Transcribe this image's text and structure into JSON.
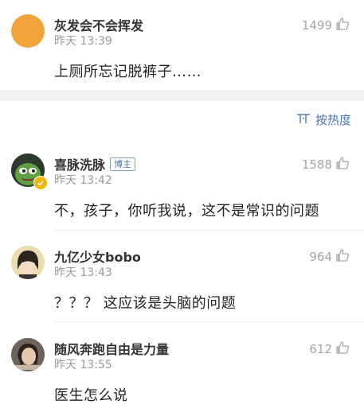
{
  "comments": [
    {
      "author": "灰发会不会挥发",
      "time": "昨天 13:39",
      "likes": "1499",
      "text": "上厕所忘记脱裤子……"
    },
    {
      "author": "喜脉洗脉",
      "badge": "博主",
      "time": "昨天 13:42",
      "likes": "1588",
      "text": "不，孩子，你听我说，这不是常识的问题"
    },
    {
      "author": "九亿少女bobo",
      "time": "昨天 13:43",
      "likes": "964",
      "text": "？？？ 这应该是头脑的问题"
    },
    {
      "author": "随风奔跑自由是力量",
      "time": "昨天 13:55",
      "likes": "612",
      "text": "医生怎么说"
    }
  ],
  "sort": {
    "label": "按热度",
    "icon": "sort-icon"
  },
  "icons": {
    "like": "thumbs-up-icon",
    "verified": "verified-badge-icon"
  },
  "colors": {
    "accent": "#4a78b0",
    "avatar1": "#f0a43a",
    "verified": "#f5b400"
  }
}
